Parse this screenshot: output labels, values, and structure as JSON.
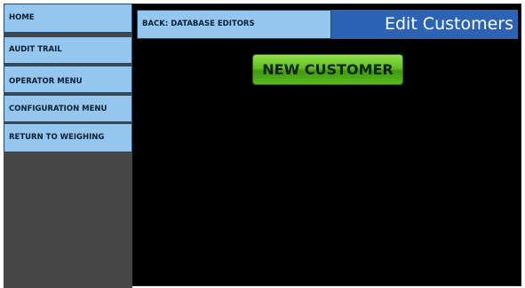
{
  "sidebar": {
    "items": [
      {
        "label": "HOME"
      },
      {
        "label": "AUDIT TRAIL"
      },
      {
        "label": "OPERATOR MENU"
      },
      {
        "label": "CONFIGURATION MENU"
      },
      {
        "label": "RETURN TO WEIGHING"
      }
    ]
  },
  "header": {
    "back_label": "BACK: DATABASE EDITORS",
    "title": "Edit Customers"
  },
  "main": {
    "new_customer_label": "NEW CUSTOMER"
  },
  "colors": {
    "nav_button": "#94c6ee",
    "title_bar": "#2d63b4",
    "sidebar_bg": "#464646",
    "content_bg": "#000000",
    "action_button": "#5fbf1f"
  }
}
